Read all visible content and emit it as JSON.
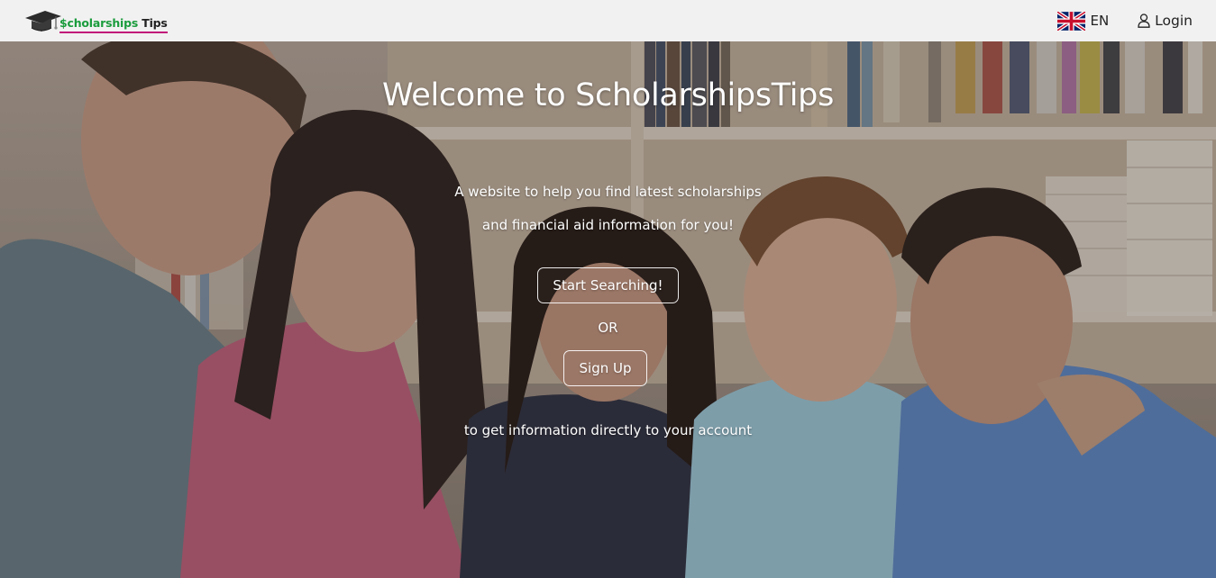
{
  "navbar": {
    "brand": {
      "dollar": "$",
      "word1": "cholarships",
      "word2": "Tips"
    },
    "language": {
      "code": "EN",
      "flag_icon": "uk-flag-icon"
    },
    "login": {
      "label": "Login",
      "icon": "user-icon"
    }
  },
  "hero": {
    "title": "Welcome to ScholarshipsTips",
    "line1": "A website to help you find latest scholarships",
    "line2": "and financial aid information for you!",
    "search_button": "Start Searching!",
    "or_text": "OR",
    "signup_button": "Sign Up",
    "footer_text": "to get information directly to your account"
  },
  "colors": {
    "navbar_bg": "#f1f1f1",
    "brand_green": "#1a9c3c",
    "brand_underline": "#c2187a",
    "hero_text": "#ffffff"
  }
}
